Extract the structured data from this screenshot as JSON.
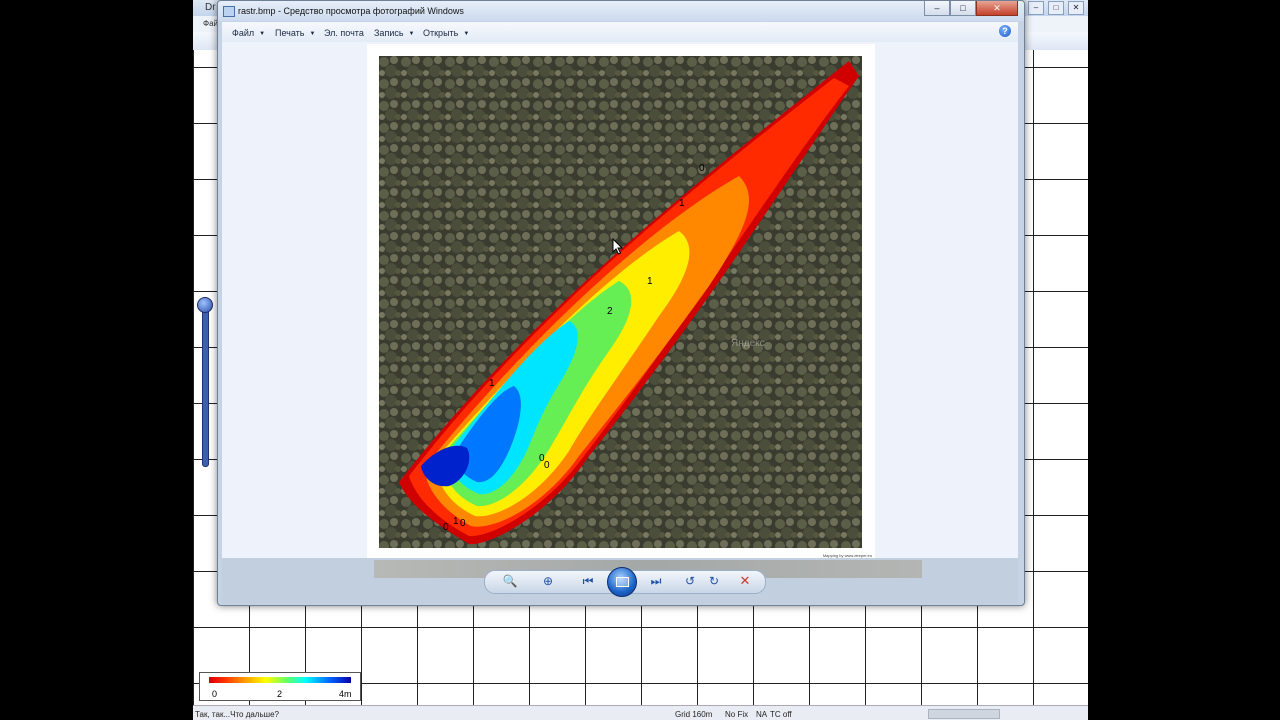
{
  "background_app": {
    "title": "Dr",
    "menu_first": "Фай",
    "window_buttons": [
      "–",
      "□",
      "✕"
    ]
  },
  "legend": {
    "ticks": [
      "0",
      "2",
      "4m"
    ],
    "colors": [
      "#d00000",
      "#ff9900",
      "#ffff00",
      "#66ff66",
      "#00ffff",
      "#0066ff",
      "#0000aa"
    ]
  },
  "statusbar": {
    "message": "Так, так...Что дальше?",
    "grid": "Grid 160m",
    "fix": "No Fix",
    "na": "NA",
    "tc": "TC off"
  },
  "viewer": {
    "title": "rastr.bmp - Средство просмотра фотографий Windows",
    "menu": [
      {
        "label": "Файл"
      },
      {
        "label": "Печать"
      },
      {
        "label": "Эл. почта"
      },
      {
        "label": "Запись"
      },
      {
        "label": "Открыть"
      }
    ],
    "help_label": "?",
    "window_buttons": [
      "–",
      "□",
      "✕"
    ],
    "image": {
      "watermark": "Яндекс",
      "credit": "Mapping by www.deeper.eu",
      "contour_labels": [
        "0",
        "1",
        "1",
        "2",
        "1",
        "0",
        "0",
        "1",
        "0",
        "0"
      ]
    },
    "controls": [
      {
        "name": "zoom",
        "symbol": "🔍"
      },
      {
        "name": "actual-size",
        "symbol": "⊕"
      },
      {
        "name": "previous",
        "symbol": "⏮"
      },
      {
        "name": "slideshow",
        "symbol": "▣"
      },
      {
        "name": "next",
        "symbol": "⏭"
      },
      {
        "name": "rotate-ccw",
        "symbol": "↺"
      },
      {
        "name": "rotate-cw",
        "symbol": "↻"
      },
      {
        "name": "delete",
        "symbol": "✕"
      }
    ]
  }
}
